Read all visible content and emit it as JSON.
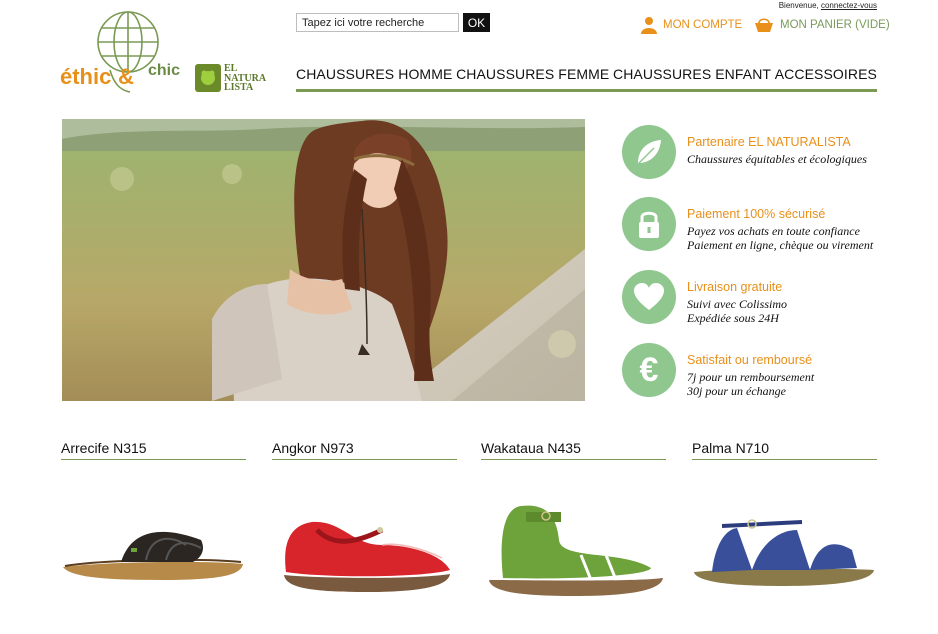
{
  "header": {
    "logo_text_1": "éthic",
    "logo_text_2": "&",
    "logo_text_3": "chic",
    "partner_logo_text": [
      "EL",
      "NATURA",
      "LISTA"
    ],
    "search": {
      "placeholder": "Tapez ici votre recherche",
      "value": "Tapez ici votre recherche",
      "button": "OK"
    },
    "welcome": "Bienvenue,",
    "connect_link": "connectez-vous",
    "account_label": "MON COMPTE",
    "cart_label": "MON PANIER (VIDE)",
    "account_icon": "user-icon",
    "cart_icon": "basket-icon"
  },
  "nav": {
    "items": [
      "CHAUSSURES HOMME",
      "CHAUSSURES FEMME",
      "CHAUSSURES ENFANT",
      "ACCESSOIRES"
    ]
  },
  "features": [
    {
      "icon": "leaf-icon",
      "title": "Partenaire EL NATURALISTA",
      "lines": [
        "Chaussures équitables et écologiques"
      ]
    },
    {
      "icon": "lock-icon",
      "title": "Paiement 100% sécurisé",
      "lines": [
        "Payez vos achats en toute confiance",
        "Paiement en ligne, chèque ou virement"
      ]
    },
    {
      "icon": "heart-icon",
      "title": "Livraison gratuite",
      "lines": [
        "Suivi avec Colissimo",
        "Expédiée sous 24H"
      ]
    },
    {
      "icon": "euro-icon",
      "title": "Satisfait ou remboursé",
      "lines": [
        "7j pour un remboursement",
        "30j pour un échange"
      ]
    }
  ],
  "products": [
    {
      "name": "Arrecife N315",
      "color": "#2b2622"
    },
    {
      "name": "Angkor N973",
      "color": "#d8252b"
    },
    {
      "name": "Wakataua N435",
      "color": "#6ea23a"
    },
    {
      "name": "Palma N710",
      "color": "#3a4f9a"
    }
  ],
  "colors": {
    "accent_orange": "#e8901a",
    "accent_green": "#7a9a54",
    "feature_circle": "#8fc78f"
  }
}
